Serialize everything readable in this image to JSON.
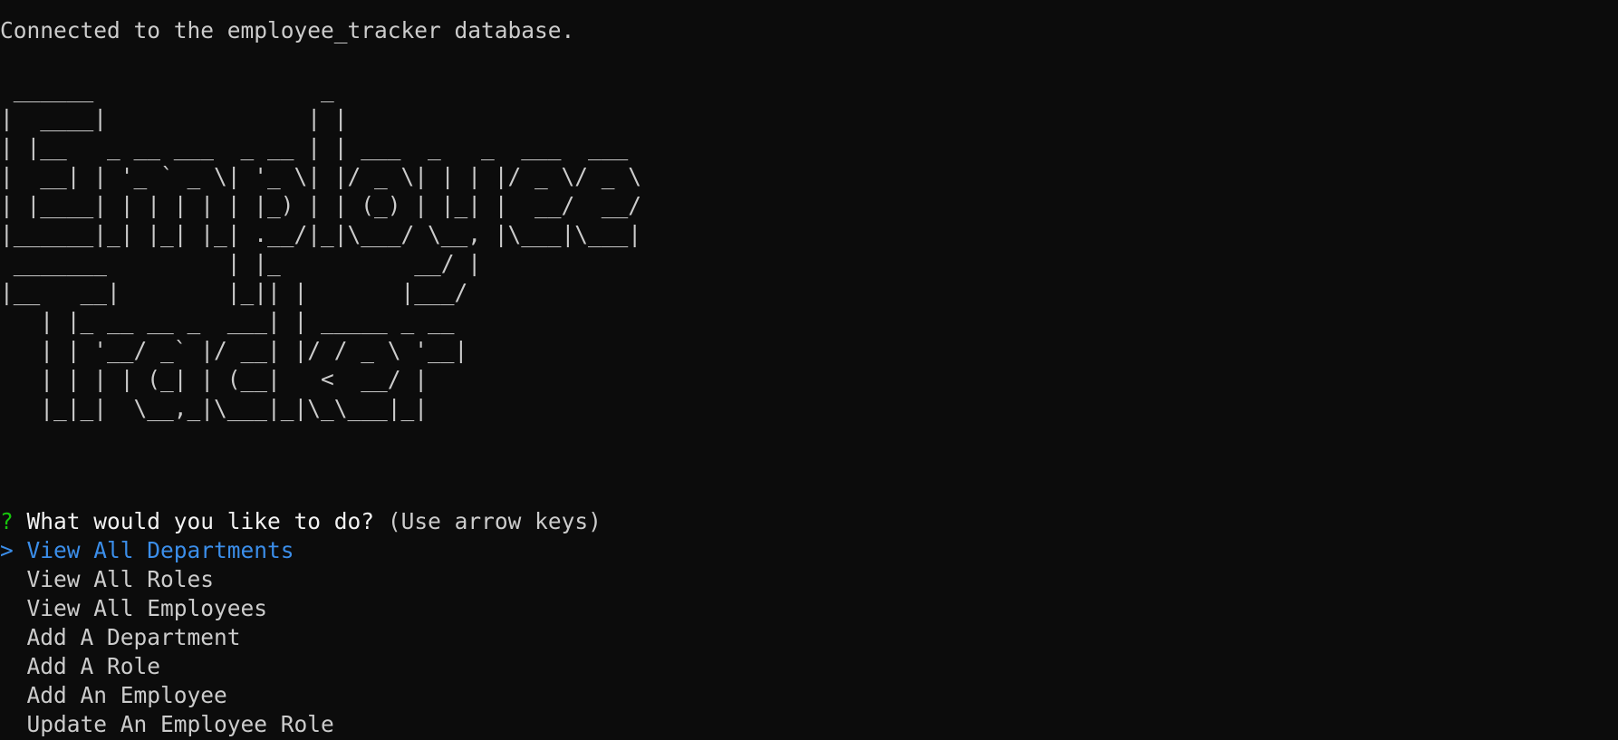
{
  "terminal": {
    "status_line": "Connected to the employee_tracker database.",
    "banner_text": " ______                 _\n|  ____|               | |\n| |__   _ __ ___  _ __ | | ___  _   _  ___  ___\n|  __| | '_ ` _ \\| '_ \\| |/ _ \\| | | |/ _ \\/ _ \\\n| |____| | | | | | |_) | | (_) | |_| |  __/  __/\n|______|_| |_| |_| .__/|_|\\___/ \\__, |\\___|\\___|\n _______         | |_          __/ |\n|__   __|        |_|| |       |___/\n   | |_ __ __ _  ___| | _____ _ __\n   | | '__/ _` |/ __| |/ / _ \\ '__|\n   | | | | (_| | (__|   <  __/ |\n   |_|_|  \\__,_|\\___|_|\\_\\___|_|"
  },
  "prompt": {
    "question_mark": "?",
    "question": "What would you like to do?",
    "hint": "(Use arrow keys)",
    "pointer": ">",
    "options": [
      "View All Departments",
      "View All Roles",
      "View All Employees",
      "Add A Department",
      "Add A Role",
      "Add An Employee",
      "Update An Employee Role"
    ],
    "selected_index": 0
  },
  "colors": {
    "background": "#0c0c0c",
    "text": "#cccccc",
    "question_mark": "#16c60c",
    "selected": "#3b8eea"
  }
}
